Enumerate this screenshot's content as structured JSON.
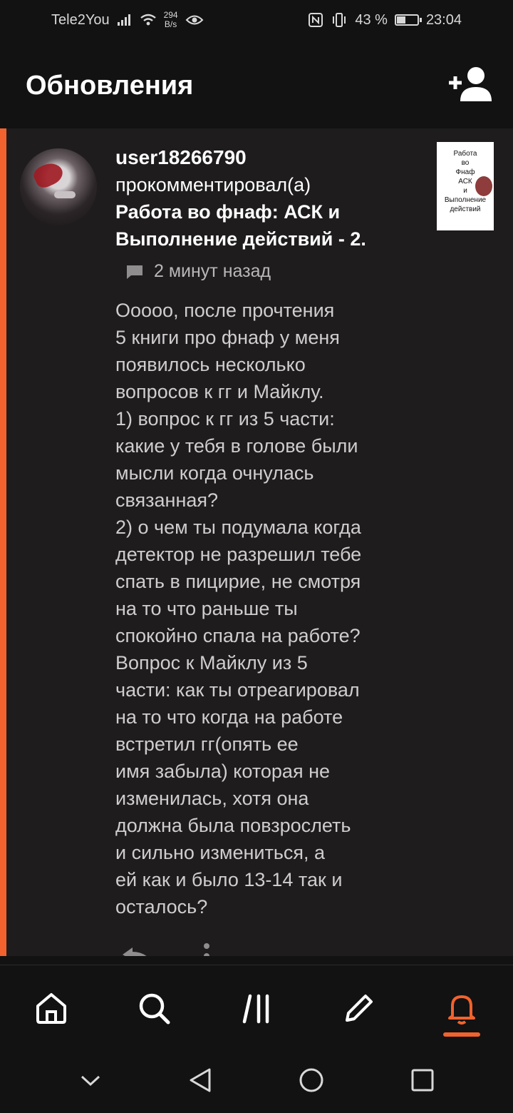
{
  "status_bar": {
    "carrier": "Tele2You",
    "net_speed_value": "294",
    "net_speed_unit": "B/s",
    "battery_percent": "43 %",
    "battery_level": 0.43,
    "time": "23:04"
  },
  "header": {
    "title": "Обновления"
  },
  "notification": {
    "username": "user18266790",
    "action": "прокомментировал(а)",
    "story_title": "Работа во фнаф: АСК и Выполнение действий - 2.",
    "time_ago": "2 минут назад",
    "thumbnail_lines": [
      "Работа",
      "во",
      "Фнаф",
      "АСК",
      "и",
      "Выполнение",
      "действий"
    ],
    "comment": "Ооооо, после прочтения\n5 книги про фнаф у меня\nпоявилось несколько\nвопросов к гг и Майклу.\n1) вопрос к гг из 5 части:\nкакие у тебя в  голове были\nмысли когда очнулась\nсвязанная?\n2) о чем ты подумала когда\nдетектор не разрешил тебе\nспать в пицирие, не смотря\nна то что раньше ты\nспокойно спала на работе?\nВопрос к Майклу из 5\nчасти: как ты отреагировал\nна то что когда на работе\nвстретил гг(опять ее\nимя забыла) которая не\nизменилась, хотя она\nдолжна была повзрослеть\nи сильно измениться, а\nей как и было 13-14 так и\nосталось?"
  },
  "colors": {
    "accent": "#f2622e",
    "background": "#121212",
    "card": "#1e1c1d"
  },
  "bottom_nav": {
    "items": [
      {
        "icon": "home-icon"
      },
      {
        "icon": "search-icon"
      },
      {
        "icon": "library-icon"
      },
      {
        "icon": "pencil-icon"
      },
      {
        "icon": "bell-icon",
        "active": true
      }
    ]
  }
}
